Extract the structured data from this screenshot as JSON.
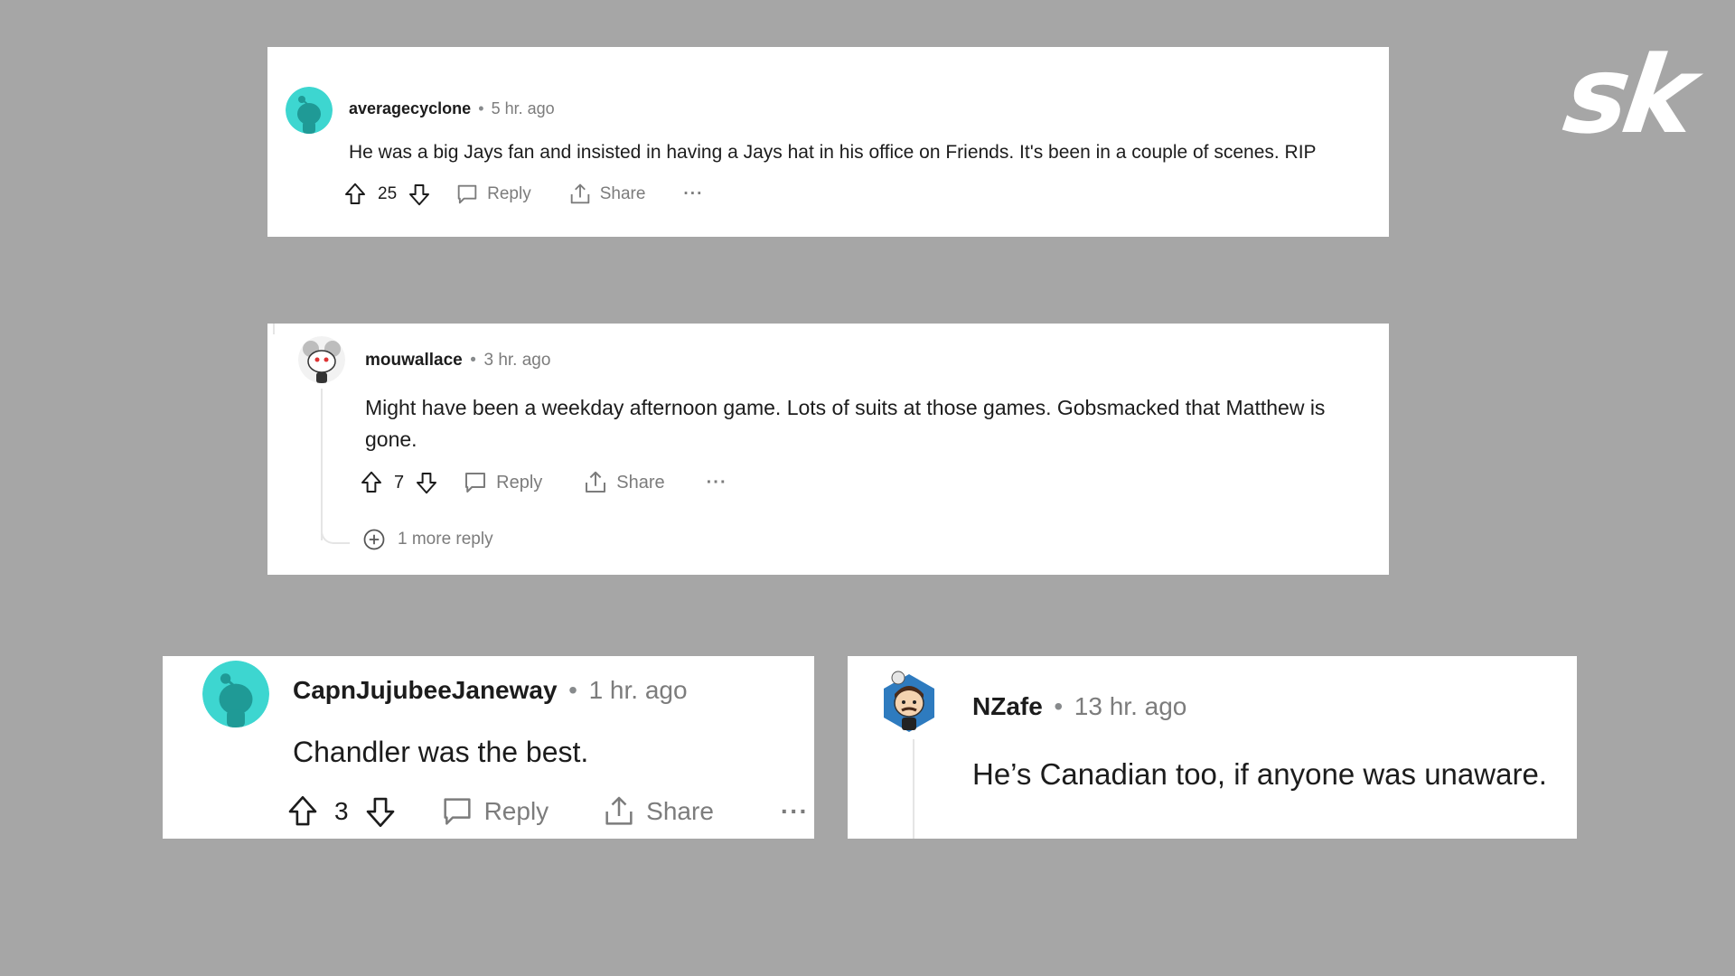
{
  "logo": {
    "text": "sk"
  },
  "comments": [
    {
      "username": "averagecyclone",
      "separator": "•",
      "time": "5 hr. ago",
      "text": "He was a big Jays fan and insisted in having a Jays hat in his office on Friends. It's been in a couple of scenes. RIP",
      "votes": "25",
      "reply_label": "Reply",
      "share_label": "Share",
      "more_label": "···"
    },
    {
      "username": "mouwallace",
      "separator": "•",
      "time": "3 hr. ago",
      "text": "Might have been a weekday afternoon game. Lots of suits at those games. Gobsmacked that Matthew is gone.",
      "votes": "7",
      "reply_label": "Reply",
      "share_label": "Share",
      "more_label": "···",
      "more_replies_label": "1 more reply"
    },
    {
      "username": "CapnJujubeeJaneway",
      "separator": "•",
      "time": "1 hr. ago",
      "text": "Chandler was the best.",
      "votes": "3",
      "reply_label": "Reply",
      "share_label": "Share",
      "more_label": "···"
    },
    {
      "username": "NZafe",
      "separator": "•",
      "time": "13 hr. ago",
      "text": "He’s Canadian too, if anyone was unaware."
    }
  ],
  "colors": {
    "background": "#a6a6a6",
    "card": "#ffffff",
    "avatar_teal": "#3dd6d0",
    "avatar_dark_teal": "#1f9a96",
    "text": "#1c1c1c",
    "muted": "#7c7c7c"
  },
  "icons": [
    "upvote-icon",
    "downvote-icon",
    "comment-icon",
    "share-icon",
    "more-icon",
    "expand-plus-icon",
    "sk-logo"
  ]
}
